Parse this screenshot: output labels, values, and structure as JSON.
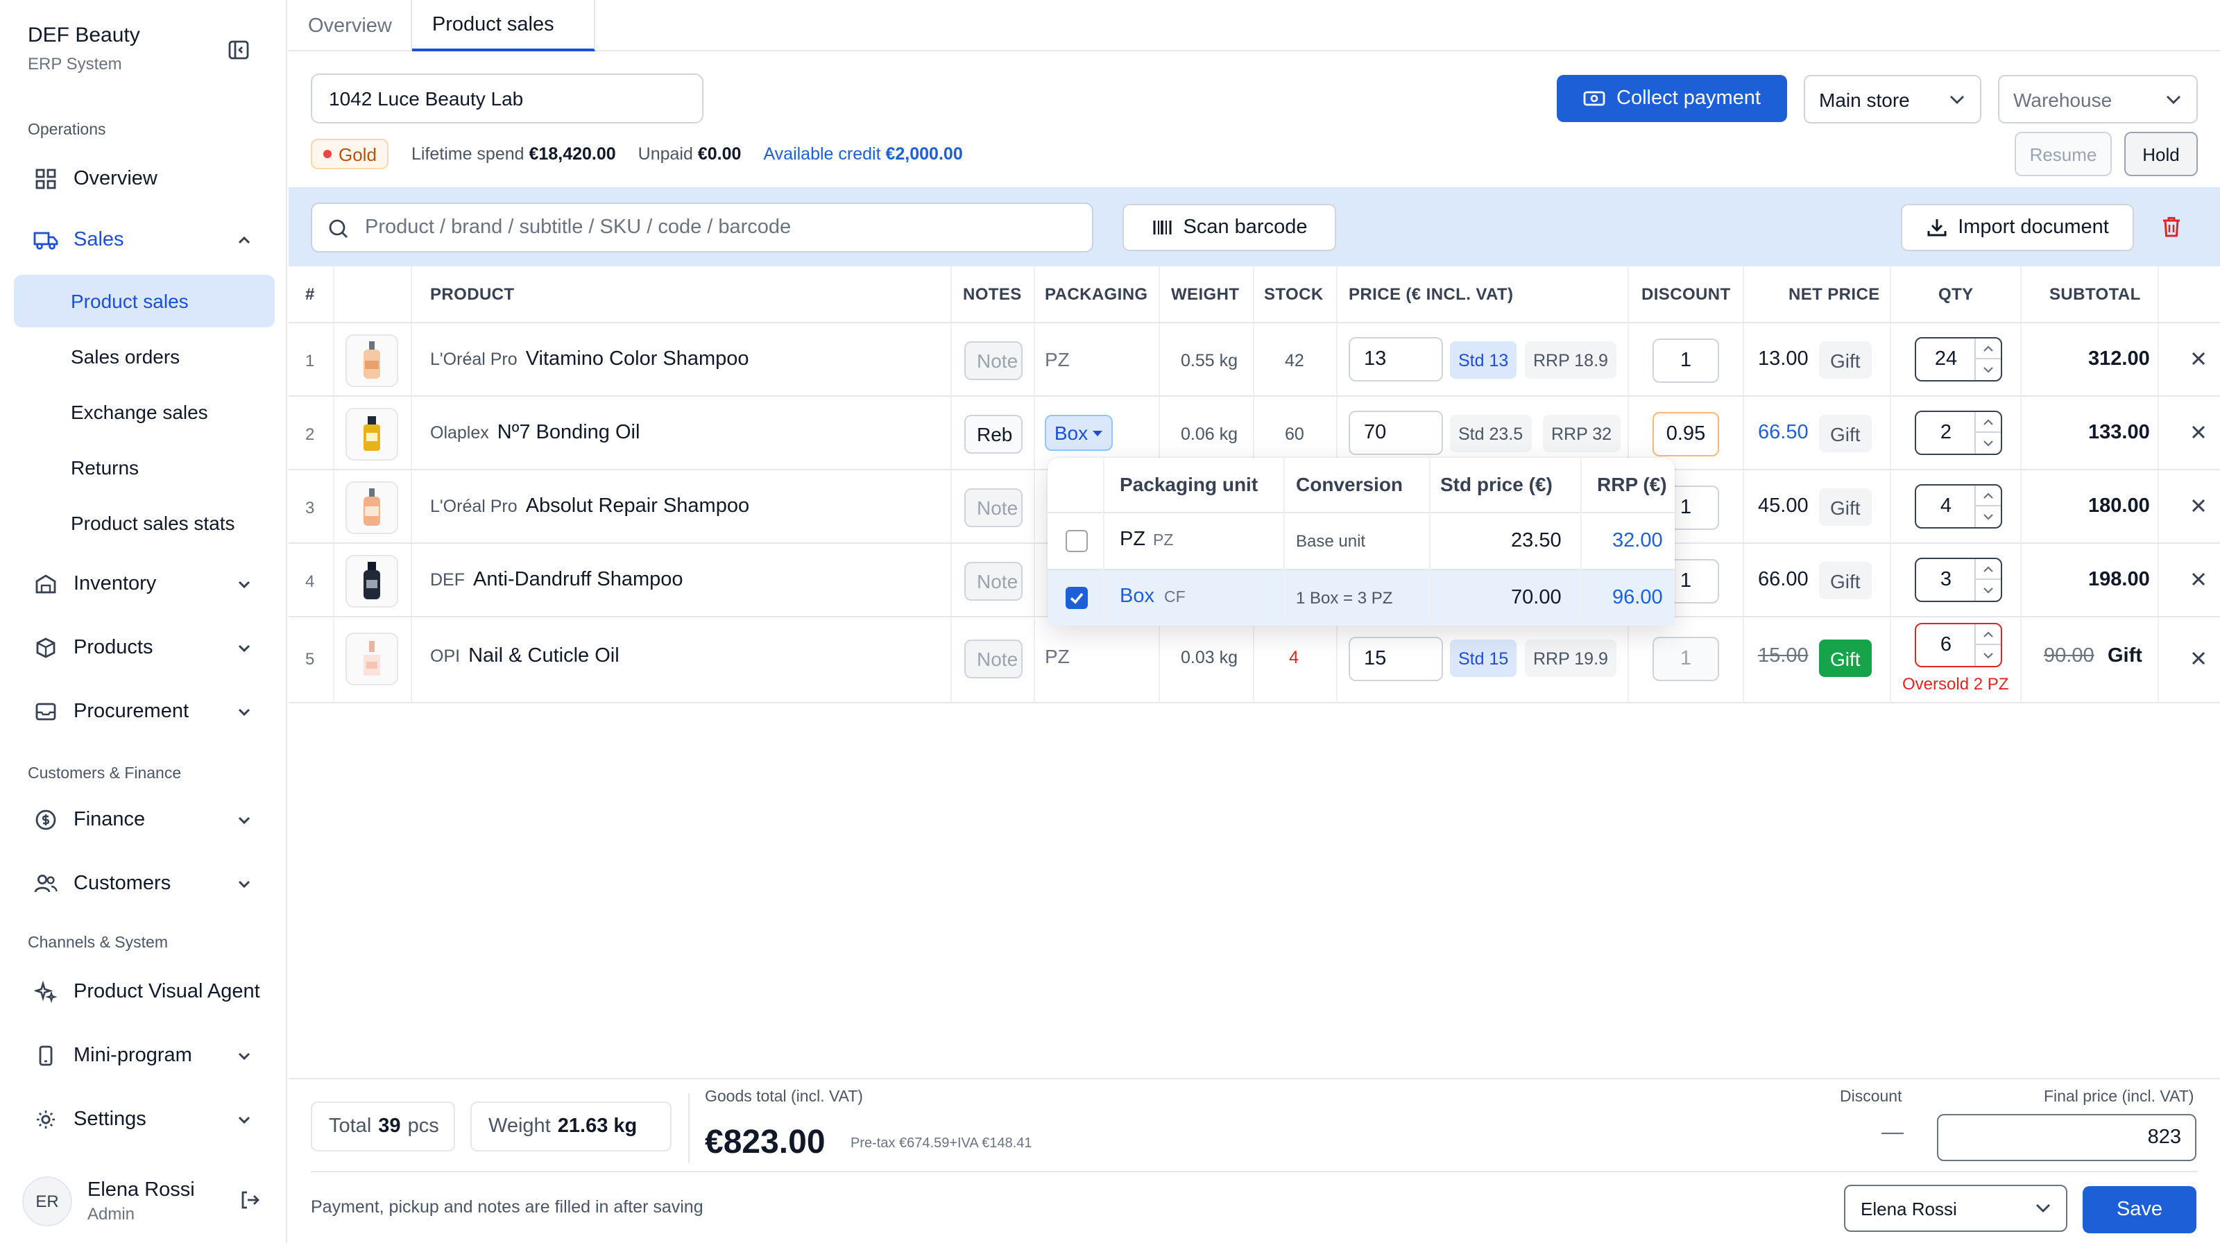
{
  "brand": {
    "name": "DEF Beauty",
    "subtitle": "ERP System"
  },
  "sidebar": {
    "sections": {
      "operations": "Operations",
      "customers_finance": "Customers & Finance",
      "channels_system": "Channels & System"
    },
    "overview": "Overview",
    "sales": "Sales",
    "sales_sub": [
      "Product sales",
      "Sales orders",
      "Exchange sales",
      "Returns",
      "Product sales stats"
    ],
    "inventory": "Inventory",
    "products": "Products",
    "procurement": "Procurement",
    "finance": "Finance",
    "customers": "Customers",
    "product_visual_agent": "Product Visual Agent",
    "mini_program": "Mini-program",
    "settings": "Settings"
  },
  "user": {
    "initials": "ER",
    "name": "Elena Rossi",
    "role": "Admin"
  },
  "tabs": [
    "Overview",
    "Product sales"
  ],
  "customer": {
    "value": "1042 Luce Beauty Lab",
    "tier": "Gold",
    "lifetime_label": "Lifetime spend",
    "lifetime_value": "€18,420.00",
    "unpaid_label": "Unpaid",
    "unpaid_value": "€0.00",
    "credit_label": "Available credit",
    "credit_value": "€2,000.00"
  },
  "toolbar": {
    "collect": "Collect payment",
    "store": "Main store",
    "warehouse": "Warehouse",
    "resume": "Resume",
    "hold": "Hold"
  },
  "search": {
    "placeholder": "Product / brand / subtitle / SKU / code / barcode",
    "scan": "Scan barcode",
    "import": "Import document"
  },
  "columns": [
    "#",
    "PRODUCT",
    "NOTES",
    "PACKAGING",
    "WEIGHT",
    "STOCK",
    "PRICE (€ INCL. VAT)",
    "DISCOUNT",
    "NET PRICE",
    "QTY",
    "SUBTOTAL"
  ],
  "rows": [
    {
      "idx": "1",
      "brand": "L'Oréal Pro",
      "name": "Vitamino Color Shampoo",
      "note": "Note",
      "packaging": "PZ",
      "weight": "0.55 kg",
      "stock": "42",
      "price": "13",
      "std": "Std 13",
      "rrp": "RRP 18.9",
      "discount": "1",
      "net": "13.00",
      "gift": "Gift",
      "qty": "24",
      "subtotal": "312.00"
    },
    {
      "idx": "2",
      "brand": "Olaplex",
      "name": "Nº7 Bonding Oil",
      "note": "Reb",
      "packaging": "Box",
      "weight": "0.06 kg",
      "stock": "60",
      "price": "70",
      "std": "Std 23.5",
      "rrp": "RRP 32",
      "discount": "0.95",
      "net": "66.50",
      "gift": "Gift",
      "qty": "2",
      "subtotal": "133.00"
    },
    {
      "idx": "3",
      "brand": "L'Oréal Pro",
      "name": "Absolut Repair Shampoo",
      "note": "Note",
      "packaging": "PZ",
      "weight": "",
      "stock": "",
      "price": "",
      "std": "",
      "rrp": "",
      "discount": "1",
      "net": "45.00",
      "gift": "Gift",
      "qty": "4",
      "subtotal": "180.00"
    },
    {
      "idx": "4",
      "brand": "DEF",
      "name": "Anti-Dandruff Shampoo",
      "note": "Note",
      "packaging": "PZ",
      "weight": "",
      "stock": "",
      "price": "",
      "std": "",
      "rrp": "",
      "discount": "1",
      "net": "66.00",
      "gift": "Gift",
      "qty": "3",
      "subtotal": "198.00"
    },
    {
      "idx": "5",
      "brand": "OPI",
      "name": "Nail & Cuticle Oil",
      "note": "Note",
      "packaging": "PZ",
      "weight": "0.03 kg",
      "stock": "4",
      "price": "15",
      "std": "Std 15",
      "rrp": "RRP 19.9",
      "discount": "1",
      "net": "15.00",
      "gift": "Gift",
      "qty": "6",
      "subtotal": "90.00",
      "subtotal_gift": "Gift",
      "oversold": "Oversold 2 PZ"
    }
  ],
  "popover": {
    "headers": [
      "Packaging unit",
      "Conversion",
      "Std price (€)",
      "RRP (€)"
    ],
    "rows": [
      {
        "unit": "PZ",
        "code": "PZ",
        "conversion": "Base unit",
        "std": "23.50",
        "rrp": "32.00",
        "checked": false
      },
      {
        "unit": "Box",
        "code": "CF",
        "conversion": "1 Box = 3 PZ",
        "std": "70.00",
        "rrp": "96.00",
        "checked": true
      }
    ]
  },
  "footer": {
    "total_label": "Total",
    "total_value": "39",
    "total_unit": "pcs",
    "weight_label": "Weight",
    "weight_value": "21.63 kg",
    "goods_label": "Goods total (incl. VAT)",
    "goods_value": "€823.00",
    "pretax": "Pre-tax €674.59+IVA €148.41",
    "discount_label": "Discount",
    "discount_value": "—",
    "final_label": "Final price (incl. VAT)",
    "final_value": "823",
    "hint": "Payment, pickup and notes are filled in after saving",
    "operator": "Elena Rossi",
    "save": "Save"
  },
  "colors": {
    "accent": "#1d5fd6",
    "active_bg": "#dbe8fb",
    "search_band": "#dce9fb",
    "danger": "#dc2626",
    "success": "#16a34a"
  }
}
